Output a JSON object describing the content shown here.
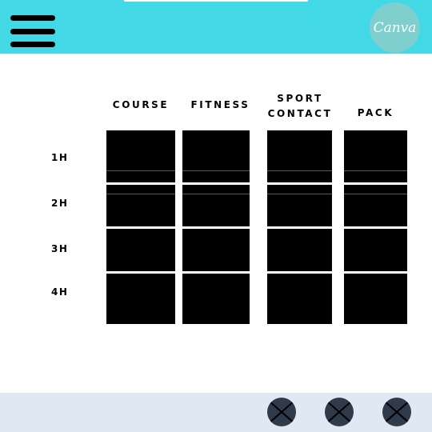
{
  "header": {
    "logo_text": "Canva",
    "menu_icon": "hamburger-icon",
    "background_color": "#42d8e6"
  },
  "grid": {
    "columns": [
      {
        "line1": "COURSE",
        "line2": ""
      },
      {
        "line1": "FITNESS",
        "line2": ""
      },
      {
        "line1": "SPORT",
        "line2": "CONTACT"
      },
      {
        "line1": "PACK",
        "line2": ""
      }
    ],
    "rows": [
      "1H",
      "2H",
      "3H",
      "4H"
    ],
    "cell_color": "#000000"
  },
  "footer": {
    "background_color": "#dfe8f3",
    "buttons": [
      {
        "icon": "close-icon"
      },
      {
        "icon": "close-icon"
      },
      {
        "icon": "close-icon"
      }
    ]
  }
}
